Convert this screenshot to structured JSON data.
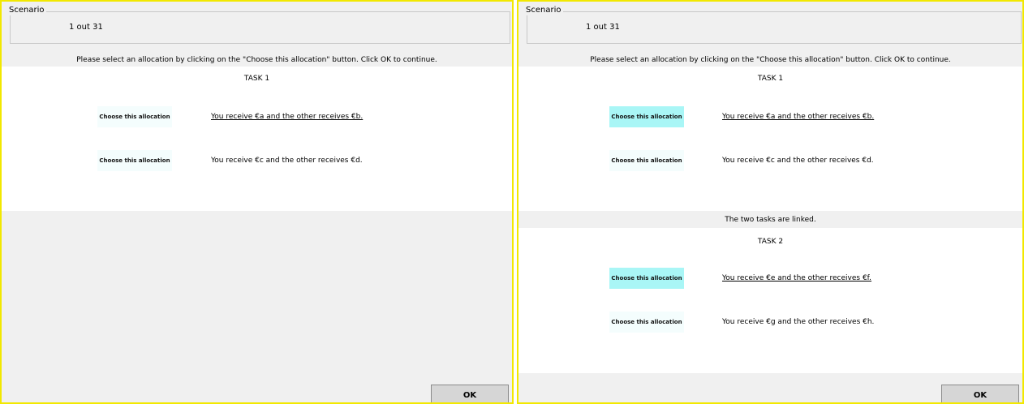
{
  "left": {
    "scenario_label": "Scenario",
    "progress": "1 out  31",
    "instruction": "Please select an allocation by clicking on the \"Choose this allocation\" button. Click OK to continue.",
    "task1": {
      "title": "TASK 1",
      "options": [
        {
          "button": "Choose this allocation",
          "text": "You receive €a and the other receives €b.",
          "selected": false
        },
        {
          "button": "Choose this allocation",
          "text": "You receive €c and the other receives €d.",
          "selected": false
        }
      ]
    },
    "ok_label": "OK"
  },
  "right": {
    "scenario_label": "Scenario",
    "progress": "1 out  31",
    "instruction": "Please select an allocation by clicking on the \"Choose this allocation\" button. Click OK to continue.",
    "task1": {
      "title": "TASK 1",
      "options": [
        {
          "button": "Choose this allocation",
          "text": "You receive €a and the other receives €b.",
          "selected": true
        },
        {
          "button": "Choose this allocation",
          "text": "You receive €c and the other receives €d.",
          "selected": false
        }
      ]
    },
    "linked_note": "The two tasks are linked.",
    "task2": {
      "title": "TASK 2",
      "options": [
        {
          "button": "Choose this allocation",
          "text": "You receive €e and the other receives €f.",
          "selected": true
        },
        {
          "button": "Choose this allocation",
          "text": "You receive €g and the other receives €h.",
          "selected": false
        }
      ]
    },
    "ok_label": "OK",
    "colors": {
      "frame_border": "#f2e800",
      "selected_button": "#a9f6f6",
      "unselected_button": "#f4fdfd"
    }
  }
}
